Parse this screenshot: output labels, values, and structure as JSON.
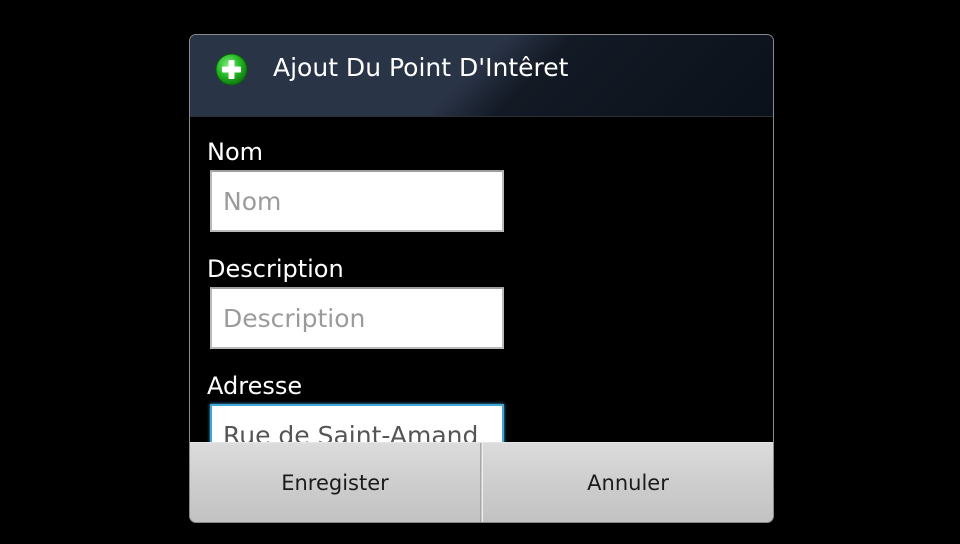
{
  "dialog": {
    "title": "Ajout Du Point D'Intêret",
    "icon": "add-circle-icon",
    "accent_color": "#3fa8d6",
    "icon_color": "#2fbf2f"
  },
  "form": {
    "name": {
      "label": "Nom",
      "placeholder": "Nom",
      "value": ""
    },
    "description": {
      "label": "Description",
      "placeholder": "Description",
      "value": ""
    },
    "address": {
      "label": "Adresse",
      "value": "Rue de Saint-Amand"
    }
  },
  "buttons": {
    "save_label": "Enregister",
    "cancel_label": "Annuler"
  }
}
